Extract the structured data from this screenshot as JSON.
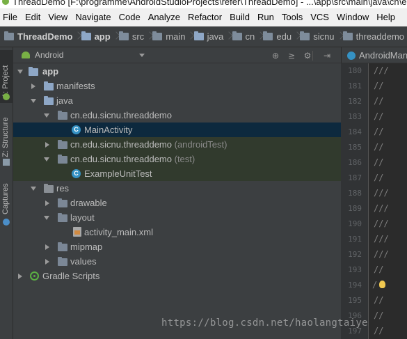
{
  "window": {
    "title": "ThreadDemo [F:\\programme\\AndroidStudioProjects\\refer\\ThreadDemo] - ...\\app\\src\\main\\java\\cn\\edu\\sicnu\\threaddemo\\MainActivity.java"
  },
  "menu": {
    "items": [
      "File",
      "Edit",
      "View",
      "Navigate",
      "Code",
      "Analyze",
      "Refactor",
      "Build",
      "Run",
      "Tools",
      "VCS",
      "Window",
      "Help"
    ]
  },
  "breadcrumb": {
    "items": [
      "ThreadDemo",
      "app",
      "src",
      "main",
      "java",
      "cn",
      "edu",
      "sicnu",
      "threaddemo"
    ]
  },
  "tool_strip": {
    "project_label": "1: Project",
    "structure_label": "Z: Structure",
    "captures_label": "Captures"
  },
  "project_panel": {
    "view_mode": "Android",
    "tree": [
      {
        "label": "app",
        "suffix": "",
        "icon": "app-module-icon",
        "expanded": true,
        "bold": true
      },
      {
        "label": "manifests",
        "suffix": "",
        "icon": "folder-icon",
        "expanded": false
      },
      {
        "label": "java",
        "suffix": "",
        "icon": "folder-icon",
        "expanded": true
      },
      {
        "label": "cn.edu.sicnu.threaddemo",
        "suffix": "",
        "icon": "package-icon",
        "expanded": true
      },
      {
        "label": "MainActivity",
        "suffix": "",
        "icon": "class-icon",
        "selected": true
      },
      {
        "label": "cn.edu.sicnu.threaddemo",
        "suffix": "(androidTest)",
        "icon": "package-icon",
        "expanded": false,
        "test": true
      },
      {
        "label": "cn.edu.sicnu.threaddemo",
        "suffix": "(test)",
        "icon": "package-icon",
        "expanded": true,
        "test": true
      },
      {
        "label": "ExampleUnitTest",
        "suffix": "",
        "icon": "class-icon",
        "test": true
      },
      {
        "label": "res",
        "suffix": "",
        "icon": "res-folder-icon",
        "expanded": true
      },
      {
        "label": "drawable",
        "suffix": "",
        "icon": "folder-icon",
        "expanded": false
      },
      {
        "label": "layout",
        "suffix": "",
        "icon": "folder-icon",
        "expanded": true
      },
      {
        "label": "activity_main.xml",
        "suffix": "",
        "icon": "xml-file-icon"
      },
      {
        "label": "mipmap",
        "suffix": "",
        "icon": "folder-icon",
        "expanded": false
      },
      {
        "label": "values",
        "suffix": "",
        "icon": "folder-icon",
        "expanded": false
      },
      {
        "label": "Gradle Scripts",
        "suffix": "",
        "icon": "gradle-icon",
        "expanded": false
      }
    ]
  },
  "editor": {
    "tab_label": "AndroidMani",
    "line_numbers": [
      "180",
      "181",
      "182",
      "183",
      "184",
      "185",
      "186",
      "187",
      "188",
      "189",
      "190",
      "191",
      "192",
      "193",
      "194",
      "195",
      "196",
      "197"
    ],
    "code_lines": [
      "///",
      "//",
      "//",
      "//",
      "//",
      "//",
      "//",
      "//",
      "///",
      "///",
      "///",
      "///",
      "///",
      "//",
      "/",
      "//",
      "//",
      "//"
    ]
  },
  "watermark": "https://blog.csdn.net/haolangtaiye"
}
